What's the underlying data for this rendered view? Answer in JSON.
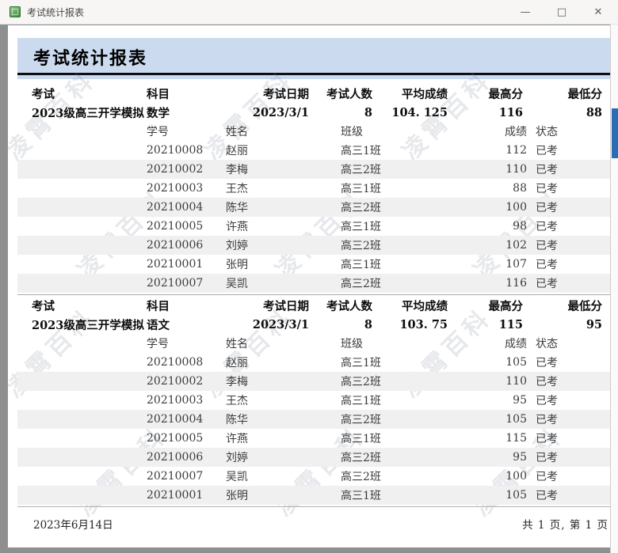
{
  "window": {
    "title": "考试统计报表",
    "controls": [
      {
        "name": "minimize",
        "glyph": "—"
      },
      {
        "name": "maximize",
        "glyph": "□"
      },
      {
        "name": "close",
        "glyph": "✕"
      }
    ]
  },
  "report": {
    "title": "考试统计报表",
    "watermark": "凌霄百科",
    "summary_headers": [
      "考试",
      "科目",
      "考试日期",
      "考试人数",
      "平均成绩",
      "最高分",
      "最低分"
    ],
    "detail_headers": [
      "学号",
      "姓名",
      "班级",
      "成绩",
      "状态"
    ],
    "sections": [
      {
        "exam": "2023级高三开学模拟",
        "subject": "数学",
        "date": "2023/3/1",
        "count": "8",
        "average": "104. 125",
        "max": "116",
        "min": "88",
        "rows": [
          [
            "20210008",
            "赵丽",
            "高三1班",
            "112",
            "已考"
          ],
          [
            "20210002",
            "李梅",
            "高三2班",
            "110",
            "已考"
          ],
          [
            "20210003",
            "王杰",
            "高三1班",
            "88",
            "已考"
          ],
          [
            "20210004",
            "陈华",
            "高三2班",
            "100",
            "已考"
          ],
          [
            "20210005",
            "许燕",
            "高三1班",
            "98",
            "已考"
          ],
          [
            "20210006",
            "刘婷",
            "高三2班",
            "102",
            "已考"
          ],
          [
            "20210001",
            "张明",
            "高三1班",
            "107",
            "已考"
          ],
          [
            "20210007",
            "吴凯",
            "高三2班",
            "116",
            "已考"
          ]
        ]
      },
      {
        "exam": "2023级高三开学模拟",
        "subject": "语文",
        "date": "2023/3/1",
        "count": "8",
        "average": "103. 75",
        "max": "115",
        "min": "95",
        "rows": [
          [
            "20210008",
            "赵丽",
            "高三1班",
            "105",
            "已考"
          ],
          [
            "20210002",
            "李梅",
            "高三2班",
            "110",
            "已考"
          ],
          [
            "20210003",
            "王杰",
            "高三1班",
            "95",
            "已考"
          ],
          [
            "20210004",
            "陈华",
            "高三2班",
            "105",
            "已考"
          ],
          [
            "20210005",
            "许燕",
            "高三1班",
            "115",
            "已考"
          ],
          [
            "20210006",
            "刘婷",
            "高三2班",
            "95",
            "已考"
          ],
          [
            "20210007",
            "吴凯",
            "高三2班",
            "100",
            "已考"
          ],
          [
            "20210001",
            "张明",
            "高三1班",
            "105",
            "已考"
          ]
        ]
      }
    ],
    "footer": {
      "date": "2023年6月14日",
      "pages": "共 1 页, 第 1 页"
    }
  },
  "colors": {
    "band": "#cbdaee",
    "zebra": "#f0f0f0",
    "scroll_thumb": "#2a6db5"
  }
}
